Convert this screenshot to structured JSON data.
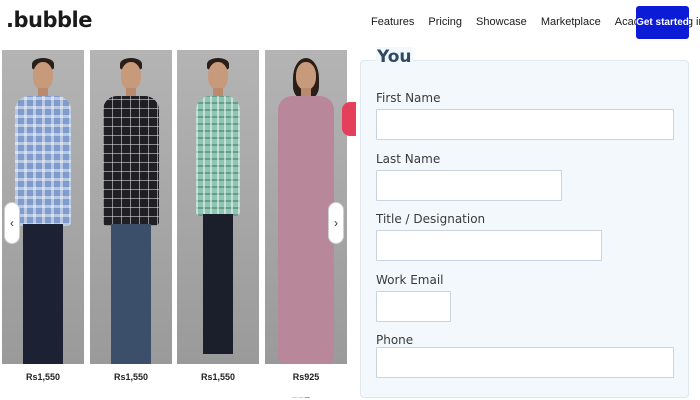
{
  "nav": {
    "logo": ".bubble",
    "links": [
      "Features",
      "Pricing",
      "Showcase",
      "Marketplace",
      "Academy",
      "Log in"
    ],
    "cta": "Get started"
  },
  "carousel": {
    "prev": "‹",
    "next": "›",
    "products": [
      {
        "price": "Rs1,550",
        "shirt_color": "#7f9ccc"
      },
      {
        "price": "Rs1,550",
        "shirt_color": "#1f1f24"
      },
      {
        "price": "Rs1,550",
        "shirt_color": "#8fc6b3"
      },
      {
        "price": "Rs925",
        "shirt_color": "#b8879a"
      }
    ]
  },
  "form": {
    "legend": "You",
    "fields": [
      {
        "label": "First Name",
        "value": ""
      },
      {
        "label": "Last Name",
        "value": ""
      },
      {
        "label": "Title / Designation",
        "value": ""
      },
      {
        "label": "Work Email",
        "value": ""
      },
      {
        "label": "Phone",
        "value": ""
      }
    ]
  },
  "colors": {
    "cta_bg": "#0c1bd6",
    "form_bg": "#f3f8fd",
    "legend": "#2f4a64"
  }
}
